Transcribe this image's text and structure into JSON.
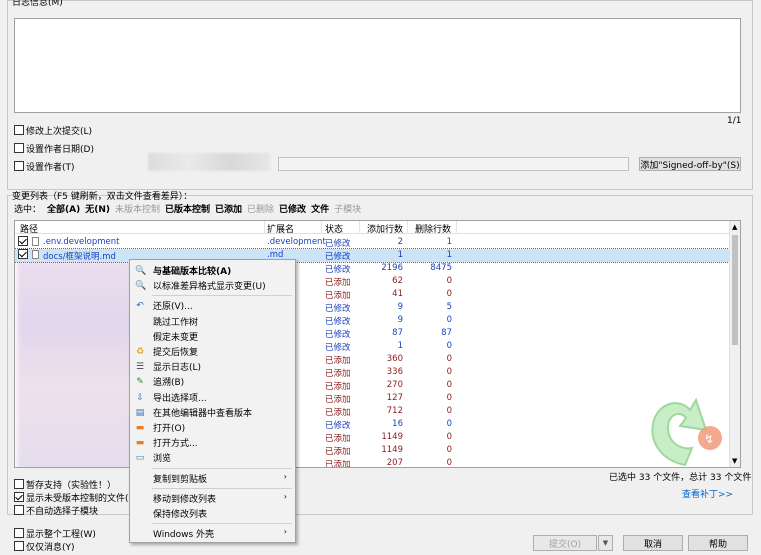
{
  "message": {
    "label": "日志信息(M)",
    "counter": "1/1"
  },
  "options": {
    "amend": "修改上次提交(L)",
    "set_date": "设置作者日期(D)",
    "set_author": "设置作者(T)",
    "signoff_button": "添加\"Signed-off-by\"(S)"
  },
  "changes": {
    "label": "变更列表（F5 键刷新，双击文件查看差异）：",
    "select_label": "选中：",
    "filters": [
      "全部(A)",
      "无(N)",
      "未版本控制",
      "已版本控制",
      "已添加",
      "已删除",
      "已修改",
      "文件",
      "子模块"
    ],
    "filter_styles": [
      "b",
      "b",
      "g",
      "b",
      "b",
      "g",
      "b",
      "b",
      "g"
    ],
    "columns": [
      "路径",
      "扩展名",
      "状态",
      "添加行数",
      "删除行数"
    ],
    "rows": [
      {
        "path": ".env.development",
        "ext": ".development",
        "status": "已修改",
        "added": "2",
        "deleted": "1",
        "checked": true,
        "status_type": "mod"
      },
      {
        "path": "docs/框架说明.md",
        "ext": ".md",
        "status": "已修改",
        "added": "1",
        "deleted": "1",
        "checked": true,
        "status_type": "mod"
      },
      {
        "path": "",
        "ext": "",
        "status": "已修改",
        "added": "2196",
        "deleted": "8475",
        "status_type": "mod"
      },
      {
        "path": "",
        "ext": "",
        "status": "已添加",
        "added": "62",
        "deleted": "0",
        "status_type": "add"
      },
      {
        "path": "",
        "ext": "",
        "status": "已添加",
        "added": "41",
        "deleted": "0",
        "status_type": "add"
      },
      {
        "path": "",
        "ext": "",
        "status": "已修改",
        "added": "9",
        "deleted": "5",
        "status_type": "mod"
      },
      {
        "path": "",
        "ext": "",
        "status": "已修改",
        "added": "9",
        "deleted": "0",
        "status_type": "mod"
      },
      {
        "path": "",
        "ext": "",
        "status": "已修改",
        "added": "87",
        "deleted": "87",
        "status_type": "mod"
      },
      {
        "path": "",
        "ext": "",
        "status": "已修改",
        "added": "1",
        "deleted": "0",
        "status_type": "mod"
      },
      {
        "path": "",
        "ext": "",
        "status": "已添加",
        "added": "360",
        "deleted": "0",
        "status_type": "add"
      },
      {
        "path": "",
        "ext": "",
        "status": "已添加",
        "added": "336",
        "deleted": "0",
        "status_type": "add"
      },
      {
        "path": "",
        "ext": "",
        "status": "已添加",
        "added": "270",
        "deleted": "0",
        "status_type": "add"
      },
      {
        "path": "",
        "ext": "",
        "status": "已添加",
        "added": "127",
        "deleted": "0",
        "status_type": "add"
      },
      {
        "path": "",
        "ext": "",
        "status": "已添加",
        "added": "712",
        "deleted": "0",
        "status_type": "add"
      },
      {
        "path": "",
        "ext": "",
        "status": "已修改",
        "added": "16",
        "deleted": "0",
        "status_type": "mod"
      },
      {
        "path": "",
        "ext": "",
        "status": "已添加",
        "added": "1149",
        "deleted": "0",
        "status_type": "add"
      },
      {
        "path": "",
        "ext": "",
        "status": "已添加",
        "added": "1149",
        "deleted": "0",
        "status_type": "add"
      },
      {
        "path": "",
        "ext": "",
        "status": "已添加",
        "added": "207",
        "deleted": "0",
        "status_type": "add"
      }
    ],
    "summary": "已选中 33 个文件，总计 33 个文件",
    "view_patch": "查看补丁>>"
  },
  "bottom_options": {
    "stash": "暂存支持（实验性！）",
    "show_unversioned": "显示未受版本控制的文件(U)",
    "no_submodules": "不自动选择子模块",
    "whole_project": "显示整个工程(W)",
    "message_only": "仅仅消息(Y)"
  },
  "buttons": {
    "commit": "提交(O)",
    "cancel": "取消",
    "help": "帮助"
  },
  "context_menu": [
    {
      "label": "与基础版本比较(A)",
      "icon": "compare-icon",
      "glyph": "🔍",
      "bold": true
    },
    {
      "label": "以标准差异格式显示变更(U)",
      "icon": "diff-icon",
      "glyph": "🔍"
    },
    {
      "sep": true
    },
    {
      "label": "还原(V)...",
      "icon": "revert-icon",
      "glyph": "↶"
    },
    {
      "label": "跳过工作树",
      "icon": "",
      "glyph": ""
    },
    {
      "label": "假定未变更",
      "icon": "",
      "glyph": ""
    },
    {
      "label": "提交后恢复",
      "icon": "restore-icon",
      "glyph": "♻"
    },
    {
      "label": "显示日志(L)",
      "icon": "log-icon",
      "glyph": "☰"
    },
    {
      "label": "追溯(B)",
      "icon": "blame-icon",
      "glyph": "✎"
    },
    {
      "label": "导出选择项...",
      "icon": "export-icon",
      "glyph": "⇩"
    },
    {
      "label": "在其他编辑器中查看版本",
      "icon": "editor-icon",
      "glyph": "▤"
    },
    {
      "label": "打开(O)",
      "icon": "open-icon",
      "glyph": "▬"
    },
    {
      "label": "打开方式...",
      "icon": "open-with-icon",
      "glyph": "▬"
    },
    {
      "label": "浏览",
      "icon": "browse-icon",
      "glyph": "▭"
    },
    {
      "sep": true
    },
    {
      "label": "复制到剪贴板",
      "icon": "",
      "glyph": "",
      "submenu": true
    },
    {
      "sep": true
    },
    {
      "label": "移动到修改列表",
      "icon": "",
      "glyph": "",
      "submenu": true
    },
    {
      "label": "保持修改列表",
      "icon": "",
      "glyph": ""
    },
    {
      "sep": true
    },
    {
      "label": "Windows 外壳",
      "icon": "",
      "glyph": "",
      "submenu": true
    }
  ]
}
